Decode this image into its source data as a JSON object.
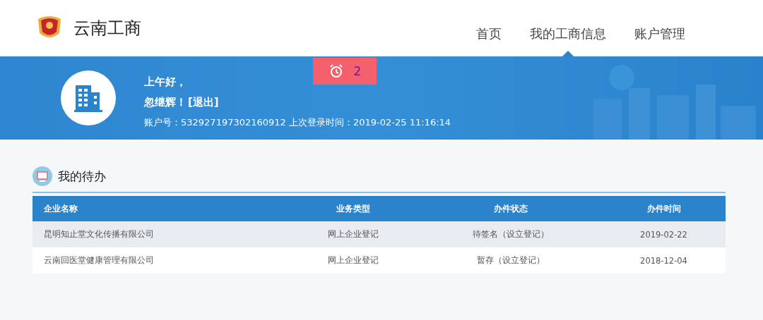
{
  "header": {
    "site_title": "云南工商",
    "nav": [
      {
        "label": "首页",
        "selected": false
      },
      {
        "label": "我的工商信息",
        "selected": true
      },
      {
        "label": "账户管理",
        "selected": false
      }
    ]
  },
  "banner": {
    "greeting": "上午好，",
    "user": "忽继辉！",
    "logout": "[退出]",
    "account": "账户号：532927197302160912 上次登录时间：2019-02-25 11:16:14",
    "alert_count": "2"
  },
  "todo": {
    "title": "我的待办",
    "columns": [
      "企业名称",
      "业务类型",
      "办件状态",
      "办件时间"
    ],
    "rows": [
      [
        "昆明知止堂文化传播有限公司",
        "网上企业登记",
        "待签名（设立登记）",
        "2019-02-22"
      ],
      [
        "云南回医堂健康管理有限公司",
        "网上企业登记",
        "暂存（设立登记）",
        "2018-12-04"
      ]
    ]
  }
}
